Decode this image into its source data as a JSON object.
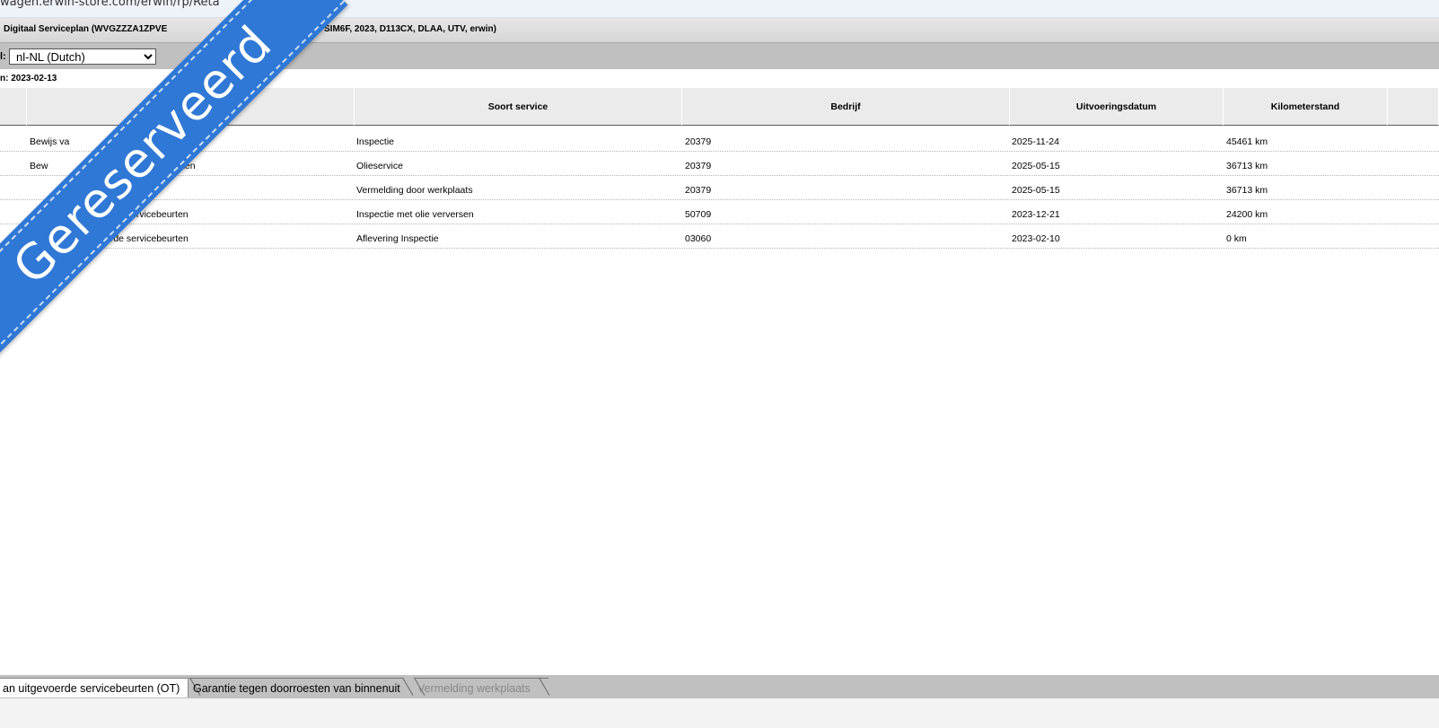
{
  "browser": {
    "url_fragment": "wagen.erwin-store.com/erwin/rp/Reta"
  },
  "header": {
    "title_left": "Digitaal Serviceplan (WVGZZZA1ZPVE",
    "title_right": "SIM6F, 2023, D113CX, DLAA, UTV, erwin)"
  },
  "language": {
    "label": "l:",
    "selected": "nl-NL (Dutch)"
  },
  "info": {
    "date_label": "n: 2023-02-13"
  },
  "table": {
    "columns": [
      "Soort service",
      "Bedrijf",
      "Uitvoeringsdatum",
      "Kilometerstand"
    ],
    "rows": [
      {
        "name": "Bewijs va",
        "type": "Inspectie",
        "company": "20379",
        "date": "2025-11-24",
        "km": "45461 km"
      },
      {
        "name": "Bew",
        "name_tail": "ten",
        "type": "Olieservice",
        "company": "20379",
        "date": "2025-05-15",
        "km": "36713 km"
      },
      {
        "name": "",
        "type": "Vermelding door werkplaats",
        "company": "20379",
        "date": "2025-05-15",
        "km": "36713 km"
      },
      {
        "name": "ervicebeurten",
        "type": "Inspectie met olie verversen",
        "company": "50709",
        "date": "2023-12-21",
        "km": "24200 km"
      },
      {
        "name": "erde servicebeurten",
        "type": "Aflevering Inspectie",
        "company": "03060",
        "date": "2023-02-10",
        "km": "0 km"
      }
    ]
  },
  "ribbon": {
    "text": "Gereserveerd",
    "color": "#2f78d6"
  },
  "tabs": [
    {
      "label": "an uitgevoerde servicebeurten (OT)"
    },
    {
      "label": "Garantie tegen doorroesten van binnenuit"
    },
    {
      "label": "Vermelding werkplaats"
    }
  ]
}
